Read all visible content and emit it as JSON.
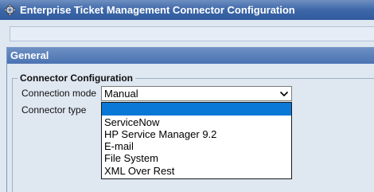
{
  "window": {
    "title": "Enterprise Ticket Management Connector Configuration",
    "icon": "gear-icon"
  },
  "panel": {
    "header": "General",
    "fieldset_legend": "Connector Configuration"
  },
  "fields": {
    "connection_mode_label": "Connection mode",
    "connection_mode_value": "Manual",
    "connector_type_label": "Connector type"
  },
  "dropdown": {
    "options": [
      "",
      "ServiceNow",
      "HP Service Manager 9.2",
      "E-mail",
      "File System",
      "XML Over Rest"
    ],
    "highlighted_index": 0
  },
  "colors": {
    "titlebar": "#3d67a8",
    "panel_header": "#4a73b2",
    "highlight": "#0a78d7",
    "background": "#dfe7f1"
  }
}
